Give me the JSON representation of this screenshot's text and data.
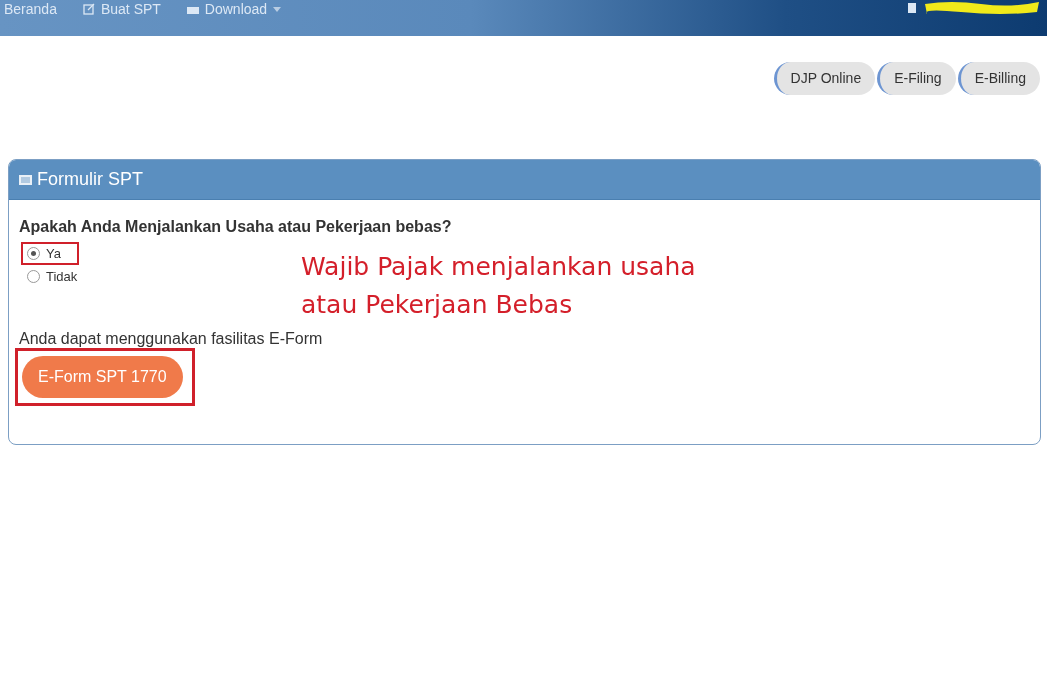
{
  "navbar": {
    "items": [
      {
        "label": "Beranda",
        "dropdown": false
      },
      {
        "label": "Buat SPT",
        "dropdown": false
      },
      {
        "label": "Download",
        "dropdown": true
      }
    ]
  },
  "quick_links": [
    "DJP Online",
    "E-Filing",
    "E-Billing"
  ],
  "panel": {
    "title": "Formulir SPT",
    "question": "Apakah Anda Menjalankan Usaha atau Pekerjaan bebas?",
    "options": [
      {
        "label": "Ya",
        "selected": true,
        "outlined_red": true
      },
      {
        "label": "Tidak",
        "selected": false,
        "outlined_red": false
      }
    ],
    "info": "Anda dapat menggunakan fasilitas E-Form",
    "button": {
      "label": "E-Form SPT 1770",
      "highlighted": true
    }
  },
  "annotation": {
    "lines": [
      "Wajib Pajak menjalankan usaha",
      "atau Pekerjaan Bebas"
    ]
  }
}
